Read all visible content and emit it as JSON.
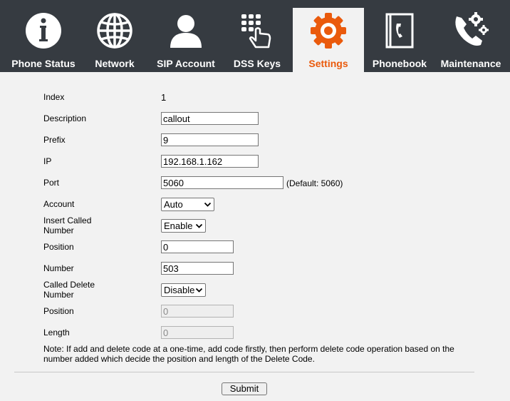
{
  "nav": {
    "tabs": [
      {
        "label": "Phone Status",
        "icon": "info-icon"
      },
      {
        "label": "Network",
        "icon": "globe-icon"
      },
      {
        "label": "SIP Account",
        "icon": "user-icon"
      },
      {
        "label": "DSS Keys",
        "icon": "keypad-hand-icon"
      },
      {
        "label": "Settings",
        "icon": "gear-icon",
        "active": true
      },
      {
        "label": "Phonebook",
        "icon": "phonebook-icon"
      },
      {
        "label": "Maintenance",
        "icon": "phone-gear-icon"
      }
    ],
    "active_color": "#ea5a0c",
    "bar_color": "#363b41"
  },
  "form": {
    "index": {
      "label": "Index",
      "value": "1"
    },
    "description": {
      "label": "Description",
      "value": "callout"
    },
    "prefix": {
      "label": "Prefix",
      "value": "9"
    },
    "ip": {
      "label": "IP",
      "value": "192.168.1.162"
    },
    "port": {
      "label": "Port",
      "value": "5060",
      "hint": "(Default: 5060)"
    },
    "account": {
      "label": "Account",
      "value": "Auto"
    },
    "insert_called_number": {
      "label_line1": "Insert Called",
      "label_line2": "Number",
      "value": "Enable"
    },
    "insert_position": {
      "label": "Position",
      "value": "0"
    },
    "number": {
      "label": "Number",
      "value": "503"
    },
    "called_delete_number": {
      "label_line1": "Called Delete",
      "label_line2": "Number",
      "value": "Disable"
    },
    "delete_position": {
      "label": "Position",
      "value": "0"
    },
    "length": {
      "label": "Length",
      "value": "0"
    }
  },
  "note": {
    "line1": "Note: If add and delete code at a one-time, add code firstly, then perform delete code operation based on the",
    "line2": "number added which decide the position and length of the Delete Code."
  },
  "submit_label": "Submit"
}
